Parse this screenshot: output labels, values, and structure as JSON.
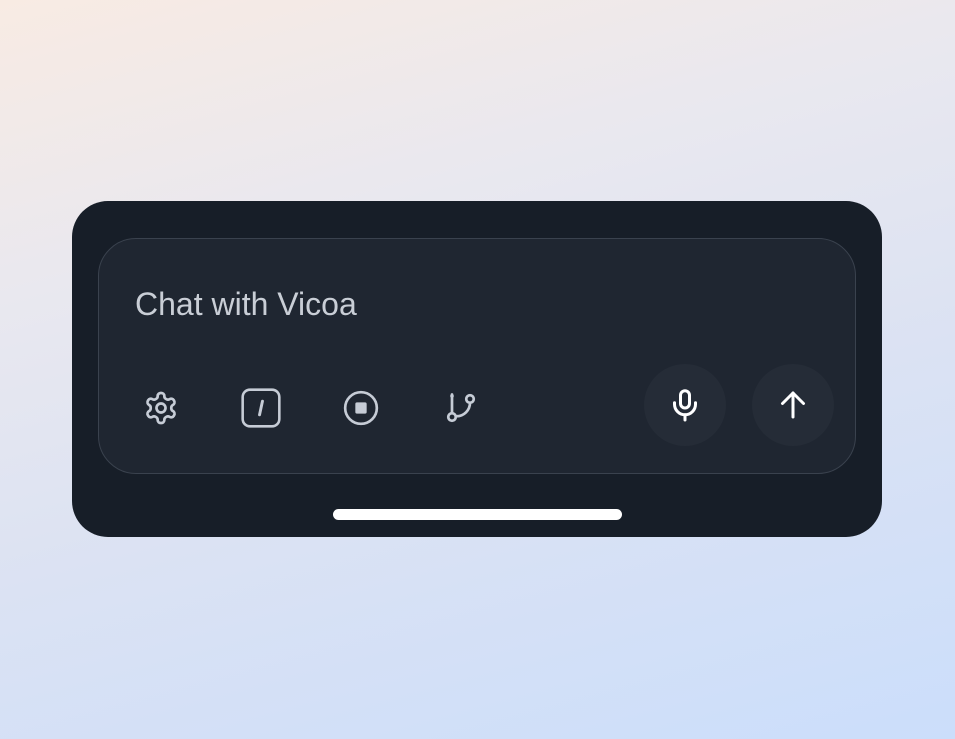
{
  "composer": {
    "placeholder": "Chat with Vicoa"
  },
  "toolbar": {
    "icons": [
      "gear-icon",
      "slash-command-icon",
      "stop-circle-icon",
      "git-branch-icon"
    ],
    "slash_label": "/"
  },
  "actions": {
    "icons": [
      "microphone-icon",
      "arrow-up-icon"
    ]
  },
  "colors": {
    "panel_bg": "#171e28",
    "composer_bg": "#1f2631",
    "composer_border": "#3a424e",
    "icon": "#c6ccd6",
    "action_icon": "#ffffff",
    "action_bg": "#252c37"
  }
}
